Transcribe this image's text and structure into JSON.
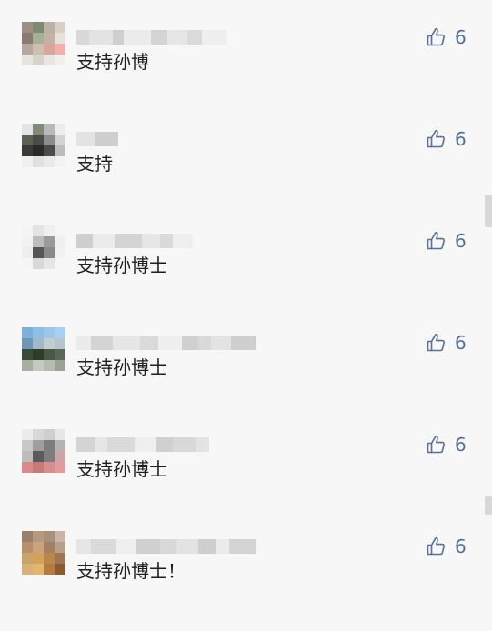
{
  "accent_color": "#56709a",
  "like_icon": "thumbs-up-icon",
  "comments": [
    {
      "text": "支持孙博",
      "likes": "6"
    },
    {
      "text": "支持",
      "likes": "6"
    },
    {
      "text": "支持孙博士",
      "likes": "6"
    },
    {
      "text": "支持孙博士",
      "likes": "6"
    },
    {
      "text": "支持孙博士",
      "likes": "6"
    },
    {
      "text": "支持孙博士！",
      "likes": "6"
    }
  ]
}
